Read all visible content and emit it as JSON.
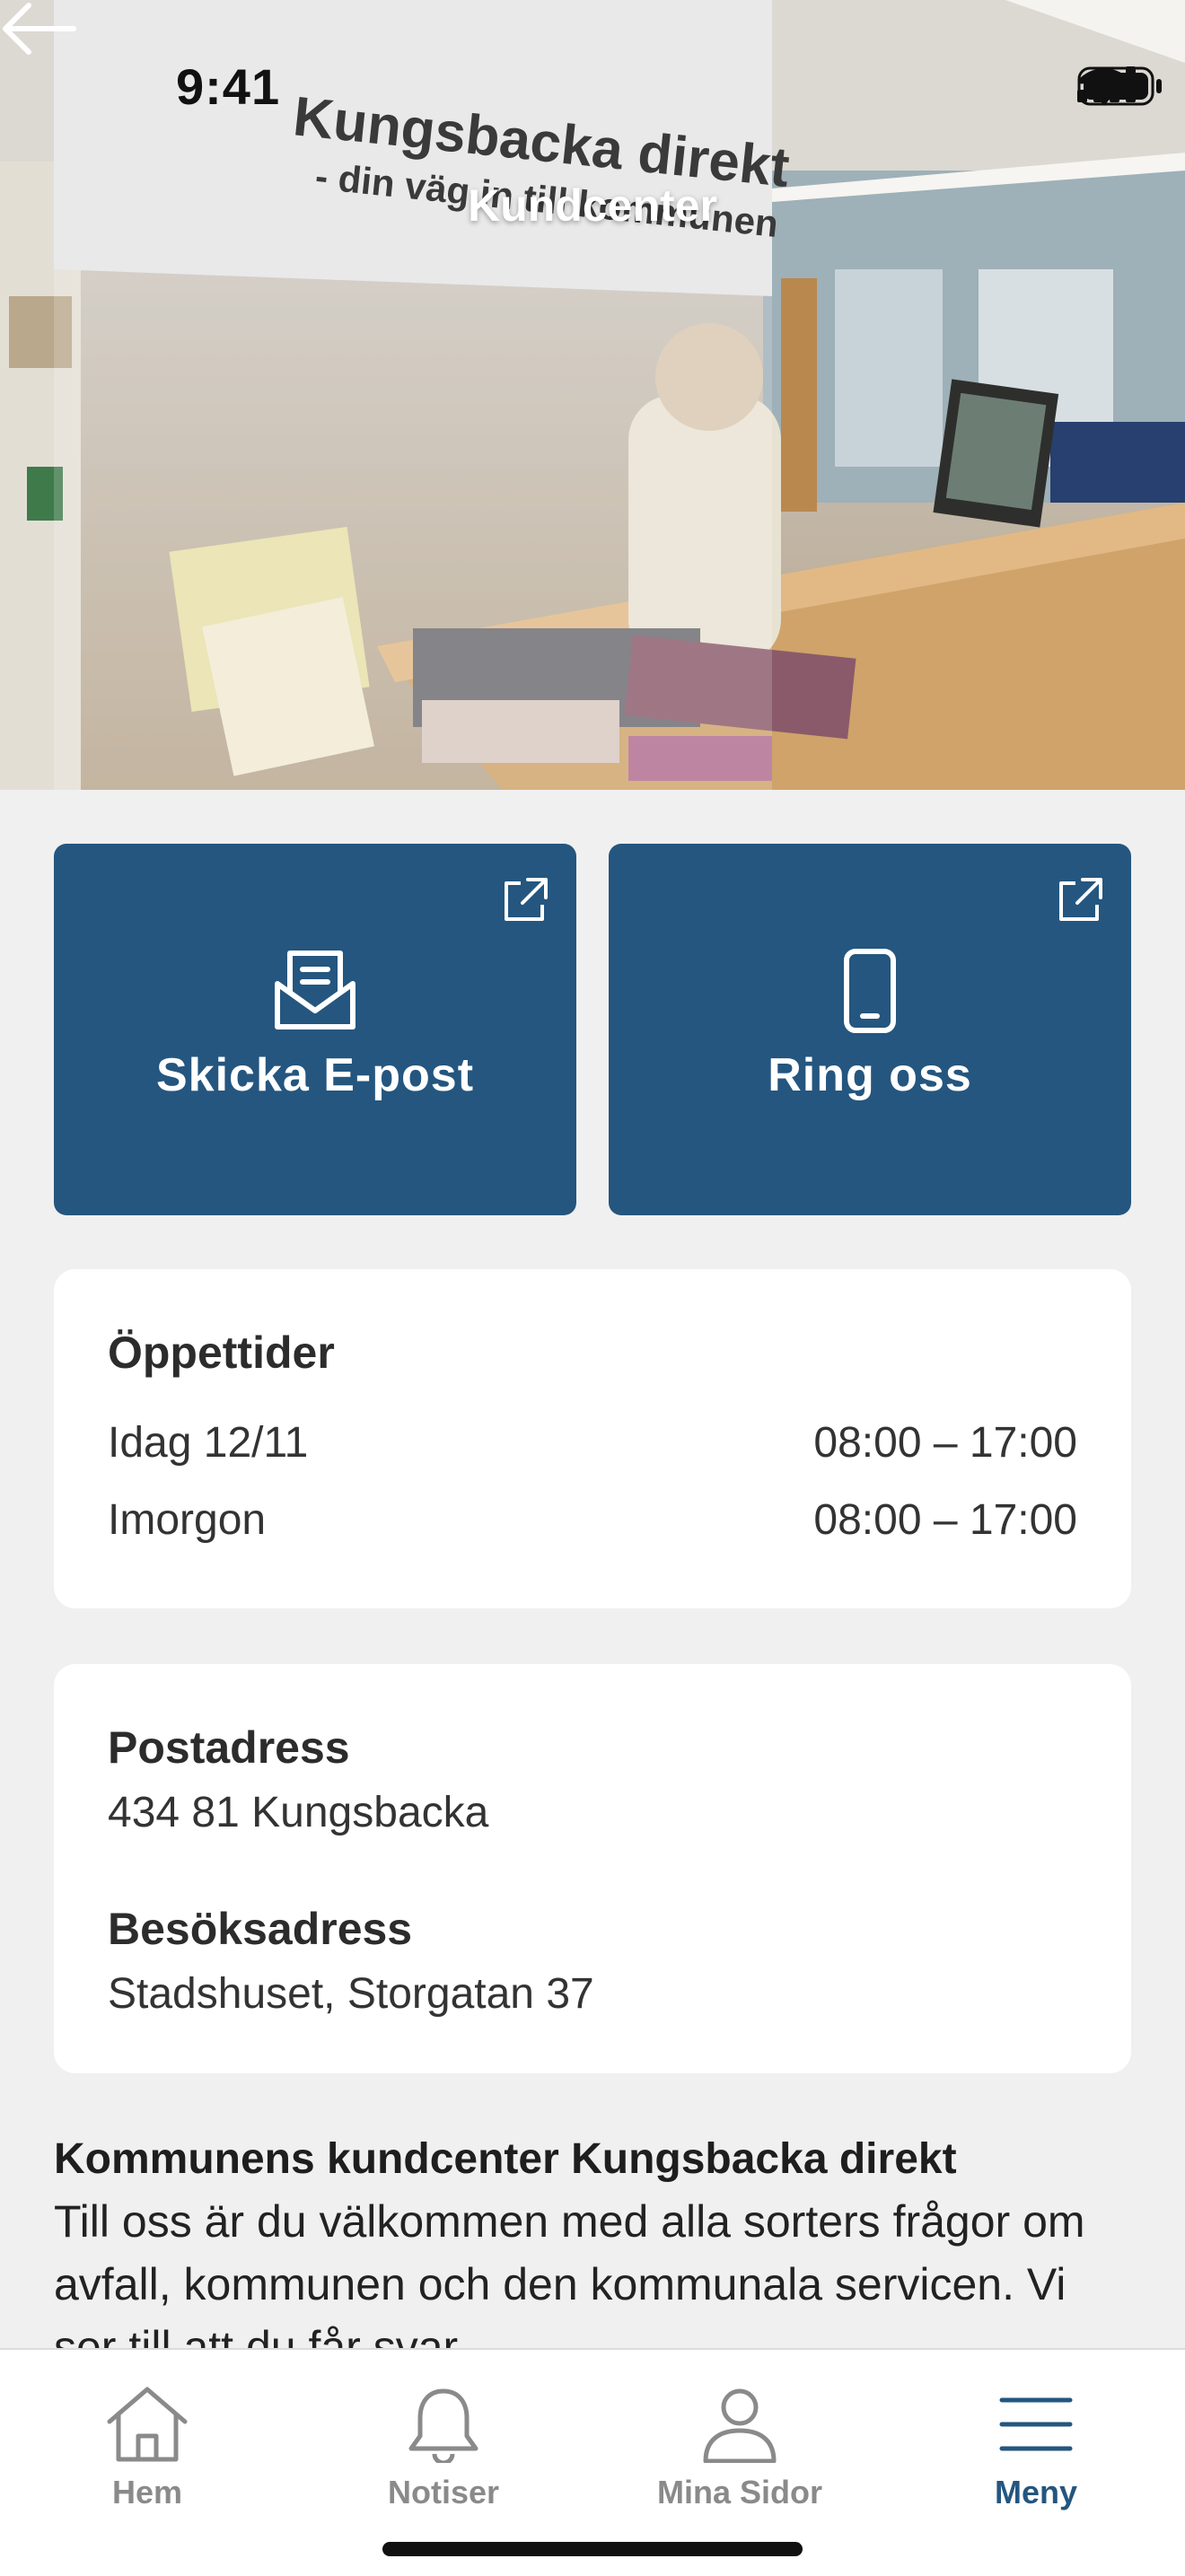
{
  "status": {
    "time": "9:41"
  },
  "header": {
    "title": "Kundcenter"
  },
  "hero": {
    "sign_line1": "Kungsbacka direkt",
    "sign_line2": "- din väg in till kommunen"
  },
  "actions": [
    {
      "label": "Skicka E-post",
      "icon": "envelope-icon"
    },
    {
      "label": "Ring oss",
      "icon": "phone-icon"
    }
  ],
  "hours": {
    "title": "Öppettider",
    "rows": [
      {
        "day": "Idag 12/11",
        "time": "08:00 – 17:00"
      },
      {
        "day": "Imorgon",
        "time": "08:00 – 17:00"
      }
    ]
  },
  "address": {
    "postal_title": "Postadress",
    "postal_value": "434 81 Kungsbacka",
    "visit_title": "Besöksadress",
    "visit_value": "Stadshuset, Storgatan 37"
  },
  "description": {
    "title": "Kommunens kundcenter Kungsbacka direkt",
    "body": "Till oss är du välkommen med alla sorters frågor om avfall, kommunen och den kommunala servicen. Vi ser till att du får svar"
  },
  "tabs": [
    {
      "label": "Hem",
      "icon": "home-icon"
    },
    {
      "label": "Notiser",
      "icon": "bell-icon"
    },
    {
      "label": "Mina Sidor",
      "icon": "person-icon"
    },
    {
      "label": "Meny",
      "icon": "menu-icon",
      "active": true
    }
  ],
  "colors": {
    "accent": "#24567f",
    "background": "#f0f0f0"
  }
}
